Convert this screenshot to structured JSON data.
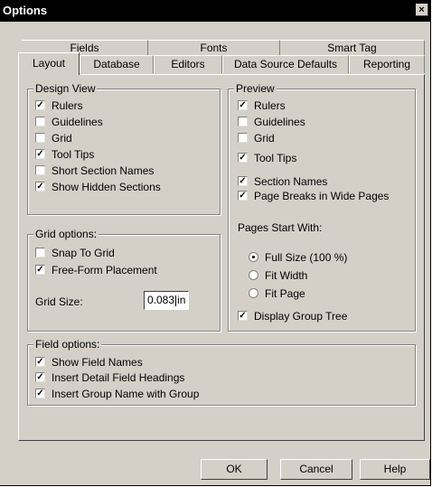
{
  "window": {
    "title": "Options",
    "close_glyph": "×"
  },
  "tabs_back": [
    "Fields",
    "Fonts",
    "Smart Tag"
  ],
  "tabs_front": [
    "Layout",
    "Database",
    "Editors",
    "Data Source Defaults",
    "Reporting"
  ],
  "active_tab": "Layout",
  "design_view": {
    "legend": "Design View",
    "items": [
      {
        "label": "Rulers",
        "checked": true
      },
      {
        "label": "Guidelines",
        "checked": false
      },
      {
        "label": "Grid",
        "checked": false
      },
      {
        "label": "Tool Tips",
        "checked": true
      },
      {
        "label": "Short Section Names",
        "checked": false
      },
      {
        "label": "Show Hidden Sections",
        "checked": true
      }
    ]
  },
  "grid_options": {
    "legend": "Grid options:",
    "items": [
      {
        "label": "Snap To Grid",
        "checked": false
      },
      {
        "label": "Free-Form Placement",
        "checked": true
      }
    ],
    "grid_size_label": "Grid Size:",
    "grid_size_value": "0.083",
    "grid_size_unit": "in"
  },
  "preview": {
    "legend": "Preview",
    "items": [
      {
        "label": "Rulers",
        "checked": true
      },
      {
        "label": "Guidelines",
        "checked": false
      },
      {
        "label": "Grid",
        "checked": false
      },
      {
        "label": "Tool Tips",
        "checked": true
      },
      {
        "label": "Section Names",
        "checked": true
      },
      {
        "label": "Page Breaks in Wide Pages",
        "checked": true
      }
    ],
    "pages_start_label": "Pages Start With:",
    "radio_options": [
      {
        "label": "Full Size (100 %)",
        "selected": true
      },
      {
        "label": "Fit Width",
        "selected": false
      },
      {
        "label": "Fit Page",
        "selected": false
      }
    ],
    "display_group_tree": {
      "label": "Display Group Tree",
      "checked": true
    }
  },
  "field_options": {
    "legend": "Field options:",
    "items": [
      {
        "label": "Show Field Names",
        "checked": true
      },
      {
        "label": "Insert Detail Field Headings",
        "checked": true
      },
      {
        "label": "Insert Group Name with Group",
        "checked": true
      }
    ]
  },
  "buttons": {
    "ok": "OK",
    "cancel": "Cancel",
    "help": "Help"
  },
  "checkmark_glyph": "✓"
}
